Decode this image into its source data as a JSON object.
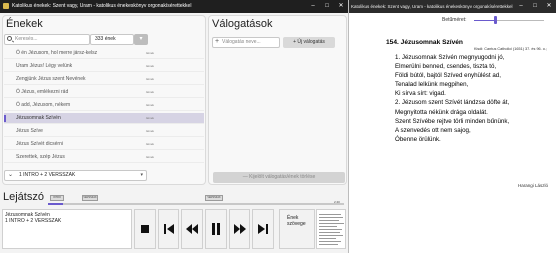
{
  "left_window": {
    "title": "Katolikus énekek: Szent vagy, Uram - katolikus énekeskönyv orgonakísérettekkel",
    "controls": [
      "–",
      "□",
      "✕"
    ]
  },
  "songs_panel": {
    "title": "Énekek",
    "search_placeholder": "Keresés...",
    "count": "333 ének",
    "items": [
      {
        "label": "Ó én Jézusom, hol merre jársz-kelsz",
        "tag": "4ének"
      },
      {
        "label": "Uram Jézus! Légy velünk",
        "tag": "4ének"
      },
      {
        "label": "Zengjünk Jézus szent Nevének",
        "tag": "4ének"
      },
      {
        "label": "Ó Jézus, emlékezni rád",
        "tag": "4ének"
      },
      {
        "label": "Ó add, Jézusom, nékem",
        "tag": "4ének"
      },
      {
        "label": "Jézusomnak Szívén",
        "tag": "4ének"
      },
      {
        "label": "Jézus Szíve",
        "tag": "4ének"
      },
      {
        "label": "Jézus Szívét dicsérni",
        "tag": "4ének"
      },
      {
        "label": "Szerettek, szép Jézus",
        "tag": "4ének"
      }
    ],
    "selected_index": 5,
    "dropdown_value": "1 INTRO + 2 VERSSZAK"
  },
  "selections_panel": {
    "title": "Válogatások",
    "search_placeholder": "Válogatás neve...",
    "new_button": "Új válogatás",
    "delete_button": "Kijelölt válogatás/ének törlése"
  },
  "player": {
    "title": "Lejátszó",
    "markers": [
      "INTRO",
      "VERSSZAK",
      "VERSSZAK"
    ],
    "time_end": "2:40",
    "progress": 0.05,
    "now_playing_lines": [
      "Jézusomnak Szívén",
      "1 INTRO + 2 VERSSZAK"
    ],
    "lyrics_button_lines": [
      "Ének",
      "szövege"
    ]
  },
  "right_window": {
    "title": "Katolikus énekek: Szent vagy, Uram - katolikus énekeskönyv orgonakísérettekkel",
    "controls": [
      "–",
      "□",
      "✕"
    ],
    "font_size_label": "Betűméret:",
    "font_size_level": 0.3,
    "song_heading": "154. Jézusomnak Szívén",
    "song_source": "Kisdi: Cantus Catholici (1651) 37. és 96. o.;",
    "lyrics": [
      "1. Jézusomnak Szívén megnyugodni jó,",
      "Elmerülni benned, csendes, tiszta tó,",
      "Földi bútól, bajtól Szíved enyhülést ad,",
      "Tenalad lelkünk megpihen,",
      "Ki sírva sírt: vigad.",
      "2. Jézusom szent Szívét lándzsa döfte át,",
      "Megnyitotta nékünk drága oldalát.",
      "Szent Szívébe rejtve törli minden bűnünk,",
      "A szenvedés ott nem sajog,",
      "Óbenne örülünk."
    ],
    "lyrics_author": "Harangi László"
  },
  "colors": {
    "accent": "#6a5acd",
    "selected_row": "#d6d3e4",
    "titlebar": "#1f1f1f"
  }
}
